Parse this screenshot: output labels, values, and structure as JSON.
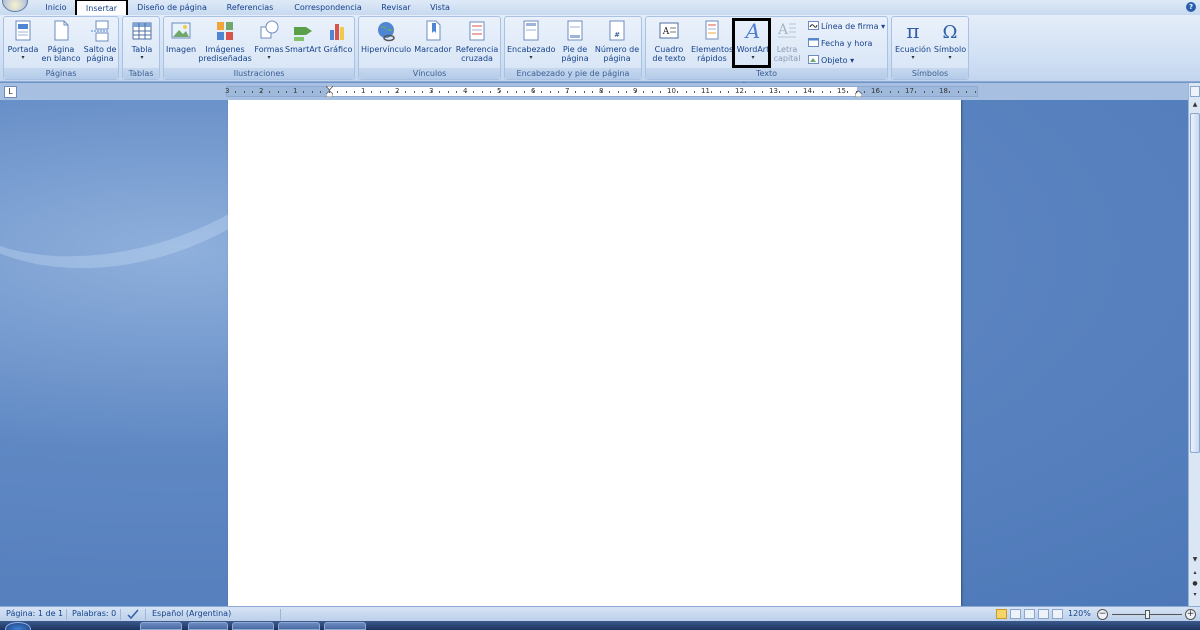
{
  "tabs": [
    "Inicio",
    "Insertar",
    "Diseño de página",
    "Referencias",
    "Correspondencia",
    "Revisar",
    "Vista"
  ],
  "active_tab": "Insertar",
  "groups": {
    "paginas": {
      "label": "Páginas",
      "portada": "Portada",
      "pagina_en_blanco_1": "Página",
      "pagina_en_blanco_2": "en blanco",
      "salto_1": "Salto de",
      "salto_2": "página"
    },
    "tablas": {
      "label": "Tablas",
      "tabla": "Tabla"
    },
    "ilustraciones": {
      "label": "Ilustraciones",
      "imagen": "Imagen",
      "imagenes_1": "Imágenes",
      "imagenes_2": "prediseñadas",
      "formas": "Formas",
      "smartart": "SmartArt",
      "grafico": "Gráfico"
    },
    "vinculos": {
      "label": "Vínculos",
      "hipervinculo": "Hipervínculo",
      "marcador": "Marcador",
      "referencia_1": "Referencia",
      "referencia_2": "cruzada"
    },
    "encabezado": {
      "label": "Encabezado y pie de página",
      "encabezado": "Encabezado",
      "pie_1": "Pie de",
      "pie_2": "página",
      "numero_1": "Número de",
      "numero_2": "página"
    },
    "texto": {
      "label": "Texto",
      "cuadro_1": "Cuadro",
      "cuadro_2": "de texto",
      "elementos_1": "Elementos",
      "elementos_2": "rápidos",
      "wordart": "WordArt",
      "letra_1": "Letra",
      "letra_2": "capital",
      "linea_firma": "Línea de firma",
      "fecha_hora": "Fecha y hora",
      "objeto": "Objeto"
    },
    "simbolos": {
      "label": "Símbolos",
      "ecuacion": "Ecuación",
      "simbolo": "Símbolo"
    }
  },
  "ruler_numbers": [
    "3",
    "2",
    "1",
    "1",
    "2",
    "3",
    "4",
    "5",
    "6",
    "7",
    "8",
    "9",
    "10",
    "11",
    "12",
    "13",
    "14",
    "15",
    "16",
    "17",
    "18"
  ],
  "status": {
    "pagina": "Página: 1 de 1",
    "palabras": "Palabras: 0",
    "idioma": "Español (Argentina)",
    "zoom": "120%"
  },
  "colors": {
    "ribbon": "#dbe7f6",
    "workspace": "#5f88c3",
    "accent_text": "#15428b"
  },
  "icons": {
    "help": "help-icon",
    "wordart": "wordart-icon",
    "highlight": "up-arrow-icon"
  }
}
